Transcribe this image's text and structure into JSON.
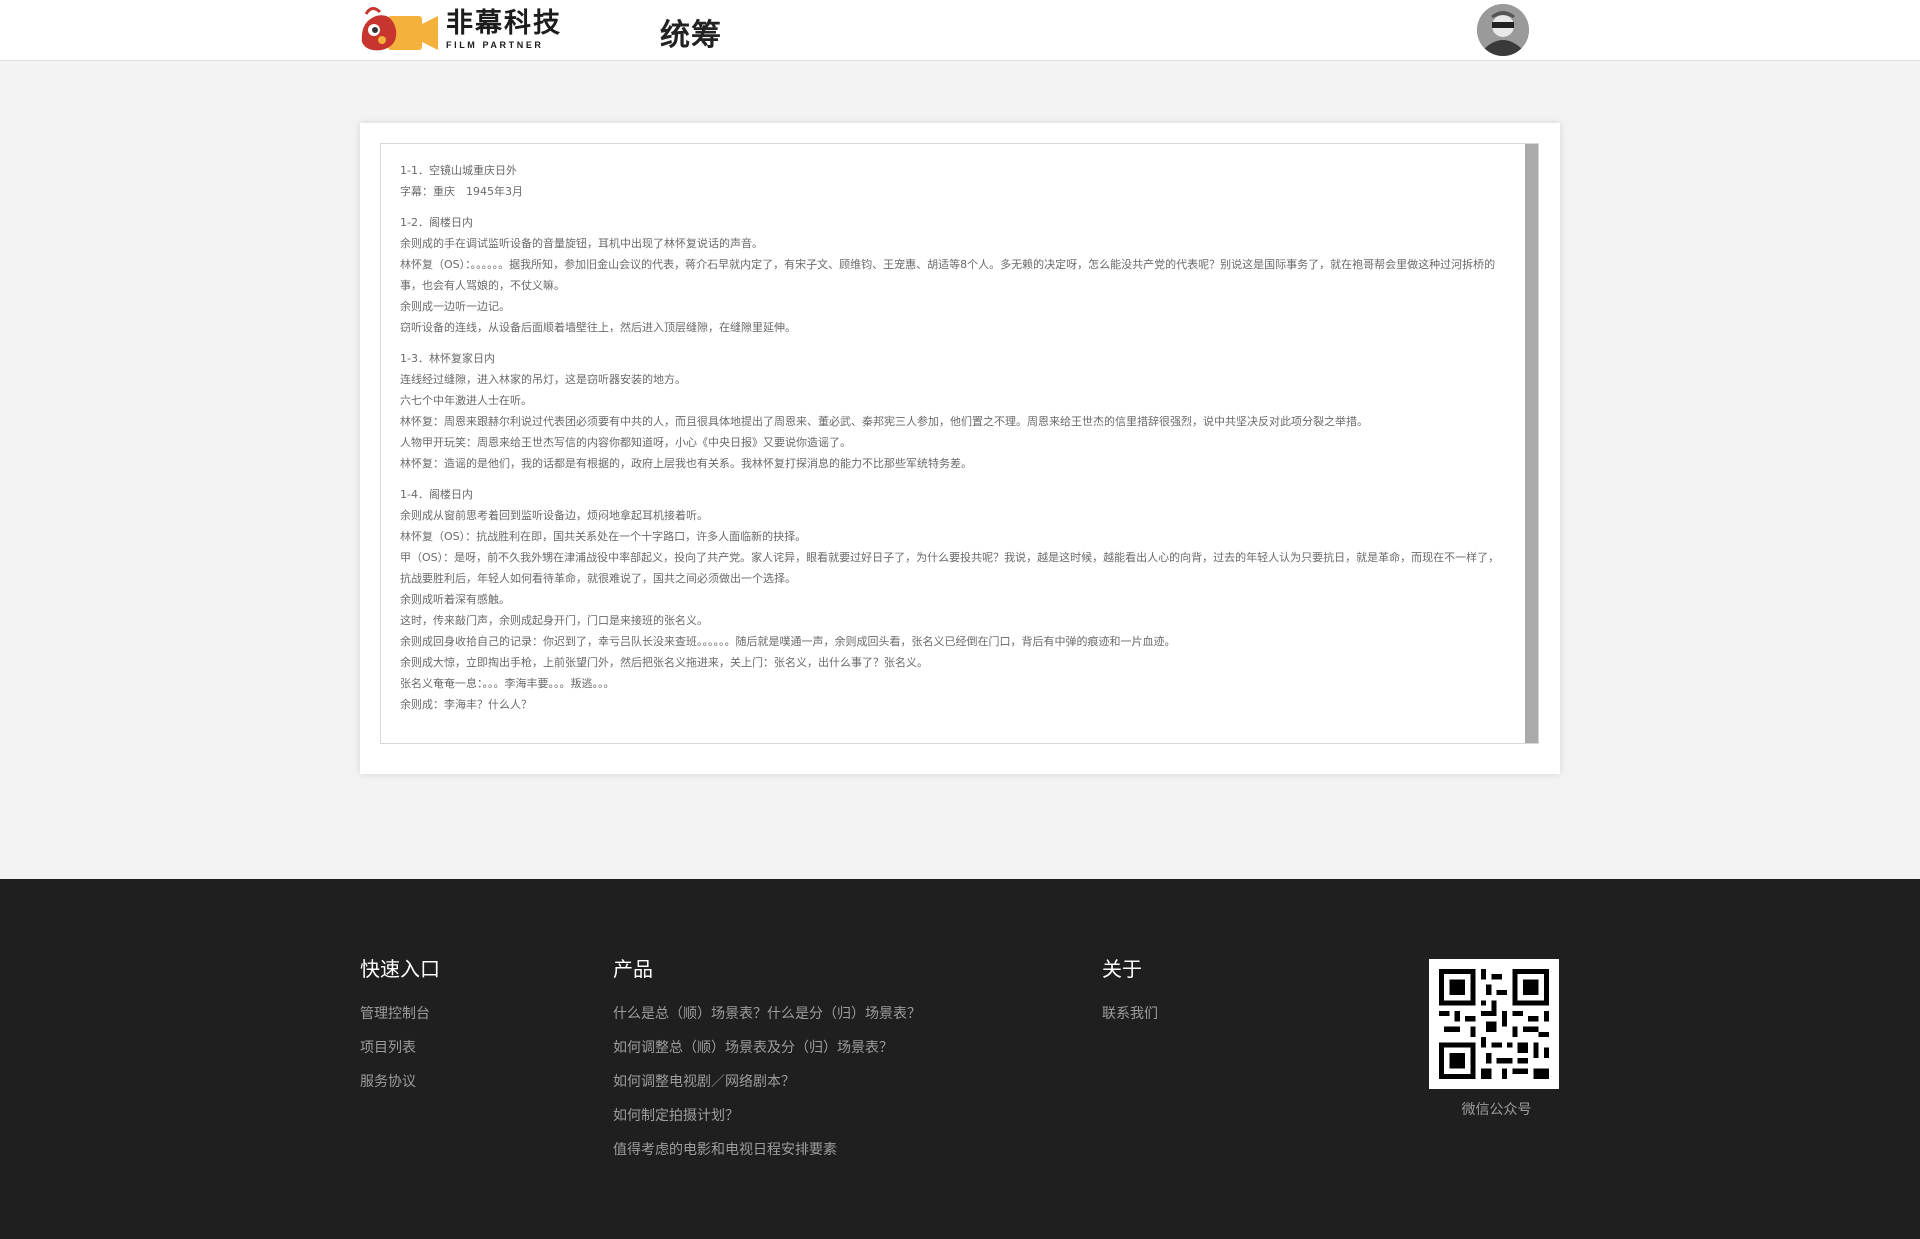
{
  "header": {
    "brand_name": "非幕科技",
    "brand_sub": "FILM PARTNER",
    "page_title": "统筹",
    "avatar_icon": "user-avatar-icon"
  },
  "script": {
    "scenes": [
      {
        "lines": [
          "1-1．空镜山城重庆日外",
          "字幕：重庆　1945年3月"
        ]
      },
      {
        "lines": [
          "1-2．阁楼日内",
          "余则成的手在调试监听设备的音量旋钮，耳机中出现了林怀复说话的声音。",
          "林怀复（OS）：。。。。。。据我所知，参加旧金山会议的代表，蒋介石早就内定了，有宋子文、顾维钧、王宠惠、胡适等8个人。多无赖的决定呀，怎么能没共产党的代表呢？别说这是国际事务了，就在袍哥帮会里做这种过河拆桥的事，也会有人骂娘的，不仗义嘛。",
          "余则成一边听一边记。",
          "窃听设备的连线，从设备后面顺着墙壁往上，然后进入顶层缝隙，在缝隙里延伸。"
        ]
      },
      {
        "lines": [
          "1-3．林怀复家日内",
          "连线经过缝隙，进入林家的吊灯，这是窃听器安装的地方。",
          "六七个中年激进人士在听。",
          "林怀复：周恩来跟赫尔利说过代表团必须要有中共的人，而且很具体地提出了周恩来、董必武、秦邦宪三人参加，他们置之不理。周恩来给王世杰的信里措辞很强烈，说中共坚决反对此项分裂之举措。",
          "人物甲开玩笑：周恩来给王世杰写信的内容你都知道呀，小心《中央日报》又要说你造谣了。",
          "林怀复：造谣的是他们，我的话都是有根据的，政府上层我也有关系。我林怀复打探消息的能力不比那些军统特务差。"
        ]
      },
      {
        "lines": [
          "1-4．阁楼日内",
          "余则成从窗前思考着回到监听设备边，烦闷地拿起耳机接着听。",
          "林怀复（OS）：抗战胜利在即，国共关系处在一个十字路口，许多人面临新的抉择。",
          "甲（OS）：是呀，前不久我外甥在津浦战役中率部起义，投向了共产党。家人诧异，眼看就要过好日子了，为什么要投共呢？我说，越是这时候，越能看出人心的向背，过去的年轻人认为只要抗日，就是革命，而现在不一样了，抗战要胜利后，年轻人如何看待革命，就很难说了，国共之间必须做出一个选择。",
          "余则成听着深有感触。",
          "这时，传来敲门声，余则成起身开门，门口是来接班的张名义。",
          "余则成回身收拾自己的记录：你迟到了，幸亏吕队长没来查班。。。。。。随后就是噗通一声，余则成回头看，张名义已经倒在门口，背后有中弹的痕迹和一片血迹。",
          "余则成大惊，立即掏出手枪，上前张望门外，然后把张名义拖进来，关上门：张名义，出什么事了？张名义。",
          "张名义奄奄一息：。。。李海丰要。。。叛逃。。。",
          "余则成：李海丰？什么人？"
        ]
      }
    ]
  },
  "footer": {
    "quick": {
      "title": "快速入口",
      "links": [
        "管理控制台",
        "项目列表",
        "服务协议"
      ]
    },
    "products": {
      "title": "产品",
      "links": [
        "什么是总（顺）场景表？什么是分（归）场景表？",
        "如何调整总（顺）场景表及分（归）场景表？",
        "如何调整电视剧／网络剧本？",
        "如何制定拍摄计划？",
        "值得考虑的电影和电视日程安排要素"
      ]
    },
    "about": {
      "title": "关于",
      "links": [
        "联系我们"
      ]
    },
    "qr_label": "微信公众号"
  }
}
